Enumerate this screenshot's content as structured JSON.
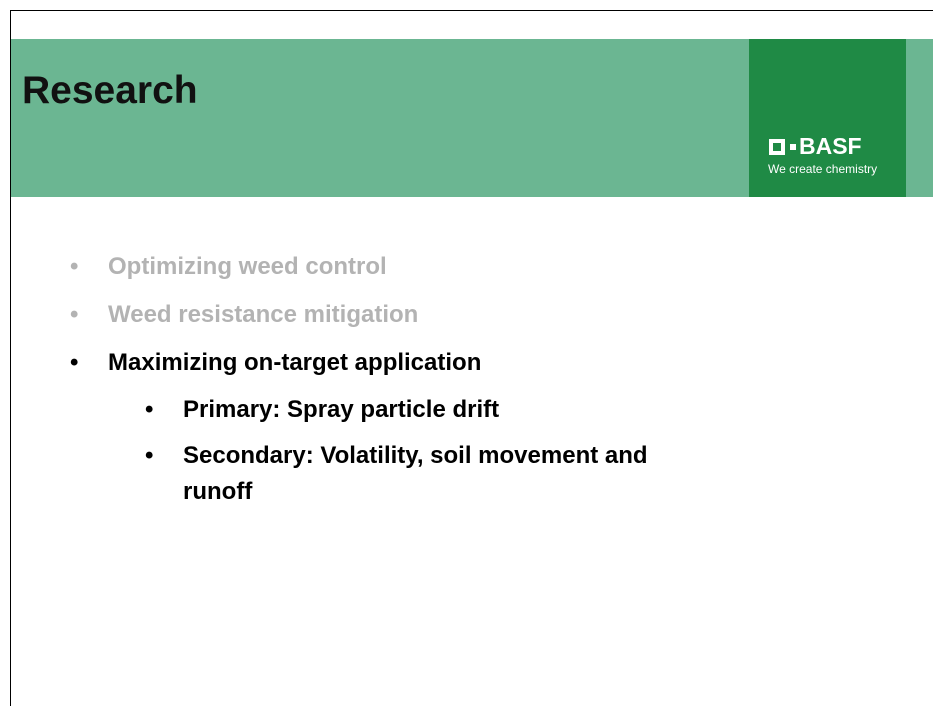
{
  "slide": {
    "title": "Research"
  },
  "logo": {
    "brand": "BASF",
    "tagline": "We create chemistry"
  },
  "bullets": [
    {
      "marker": "•",
      "text": "Optimizing weed control"
    },
    {
      "marker": "•",
      "text": "Weed resistance mitigation"
    },
    {
      "marker": "•",
      "text": "Maximizing on-target application"
    }
  ],
  "sub_bullets": [
    {
      "marker": "•",
      "text": "Primary: Spray particle drift"
    },
    {
      "marker": "•",
      "text": "Secondary: Volatility, soil movement and",
      "continuation": "runoff"
    }
  ],
  "colors": {
    "header_band": "#6bb692",
    "logo_box": "#1f8a45",
    "dimmed_text": "#b3b3b3",
    "active_text": "#000000"
  }
}
